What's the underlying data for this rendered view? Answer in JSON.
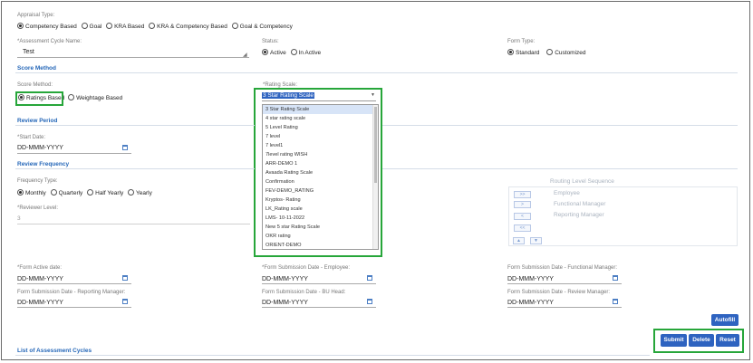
{
  "appraisal_type": {
    "label": "Appraisal Type:",
    "options": [
      "Competency Based",
      "Goal",
      "KRA Based",
      "KRA & Competency Based",
      "Goal & Competency"
    ],
    "selected": 0
  },
  "assessment_cycle": {
    "label": "*Assessment Cycle Name:",
    "value": "Test"
  },
  "status": {
    "label": "Status:",
    "options": [
      "Active",
      "In Active"
    ],
    "selected": 0
  },
  "form_type": {
    "label": "Form Type:",
    "options": [
      "Standard",
      "Customized"
    ],
    "selected": 0
  },
  "sections": {
    "score_method": "Score Method",
    "review_period": "Review Period",
    "review_frequency": "Review Frequency",
    "list_cycles": "List of Assessment Cycles"
  },
  "score_method": {
    "label": "Score Method:",
    "options": [
      "Ratings Based",
      "Weightage Based"
    ],
    "selected": 0
  },
  "rating_scale": {
    "label": "*Rating Scale:",
    "selected_value": "3 Star Rating Scale",
    "options": [
      "3 Star Rating Scale",
      "4 star rating scale",
      "5 Level Rating",
      "7 level",
      "7 level1",
      "7level rating WISH",
      "ARR-DEMO 1",
      "Avaada Rating Scale",
      "Confirmation",
      "FEV-DEMO_RATING",
      "Kryptos- Rating",
      "LK_Rating scale",
      "LMS- 10-11-2022",
      "New 5 star Rating Scale",
      "OKR rating",
      "ORIENT-DEMO"
    ]
  },
  "start_date": {
    "label": "*Start Date:",
    "value": "DD-MMM-YYYY"
  },
  "frequency": {
    "label": "Frequency Type:",
    "options": [
      "Monthly",
      "Quarterly",
      "Half Yearly",
      "Yearly"
    ],
    "selected": 0
  },
  "reviewer_level": {
    "label": "*Reviewer Level:",
    "value": "3"
  },
  "routing": {
    "title": "Routing Level Sequence",
    "items": [
      "Employee",
      "Functional Manager",
      "Reporting Manager"
    ],
    "buttons": [
      ">>",
      ">",
      "<",
      "<<"
    ]
  },
  "dates": {
    "form_active": {
      "label": "*Form Active date:",
      "value": "DD-MMM-YYYY"
    },
    "sub_employee": {
      "label": "*Form Submission Date - Employee:",
      "value": "DD-MMM-YYYY"
    },
    "sub_functional": {
      "label": "Form Submission Date - Functional Manager:",
      "value": "DD-MMM-YYYY"
    },
    "sub_reporting": {
      "label": "Form Submission Date - Reporting Manager:",
      "value": "DD-MMM-YYYY"
    },
    "sub_buhead": {
      "label": "Form Submission Date - BU Head:",
      "value": "DD-MMM-YYYY"
    },
    "sub_review": {
      "label": "Form Submission Date - Review Manager:",
      "value": "DD-MMM-YYYY"
    }
  },
  "buttons": {
    "autofill": "Autofill",
    "submit": "Submit",
    "delete": "Delete",
    "reset": "Reset"
  },
  "colors": {
    "highlight": "#27a63a",
    "primary": "#2e63c0",
    "section": "#2466b8"
  }
}
